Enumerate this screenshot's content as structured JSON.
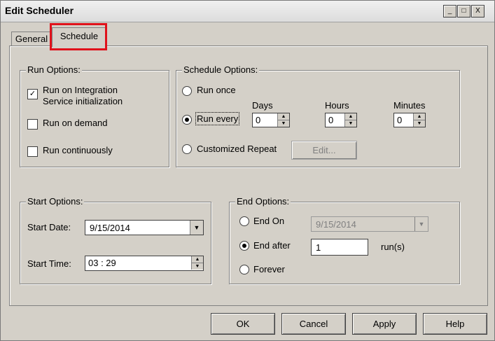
{
  "window": {
    "title": "Edit Scheduler",
    "controls": [
      "_",
      "□",
      "X"
    ]
  },
  "tabs": [
    {
      "label": "General"
    },
    {
      "label": "Schedule"
    }
  ],
  "run_options": {
    "legend": "Run Options:",
    "items": [
      {
        "label_line1": "Run on Integration",
        "label_line2": "Service initialization",
        "checked_mark": "✓"
      },
      {
        "label": "Run on demand"
      },
      {
        "label": "Run continuously"
      }
    ]
  },
  "schedule_options": {
    "legend": "Schedule Options:",
    "run_once": "Run once",
    "run_every": "Run every",
    "days_label": "Days",
    "hours_label": "Hours",
    "minutes_label": "Minutes",
    "days_value": "0",
    "hours_value": "0",
    "minutes_value": "0",
    "customized_repeat": "Customized Repeat",
    "edit_button": "Edit..."
  },
  "start_options": {
    "legend": "Start Options:",
    "start_date_label": "Start Date:",
    "start_date_value": "9/15/2014",
    "start_time_label": "Start Time:",
    "start_time_value": "03 : 29"
  },
  "end_options": {
    "legend": "End Options:",
    "end_on": "End On",
    "end_on_date": "9/15/2014",
    "end_after": "End after",
    "end_after_value": "1",
    "runs_label": "run(s)",
    "forever": "Forever"
  },
  "buttons": {
    "ok": "OK",
    "cancel": "Cancel",
    "apply": "Apply",
    "help": "Help"
  }
}
